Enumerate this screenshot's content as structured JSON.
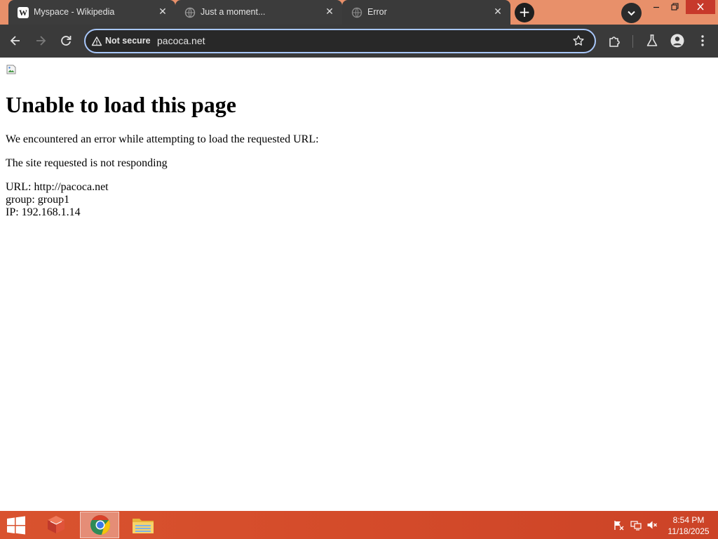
{
  "browser": {
    "tabs": [
      {
        "title": "Myspace - Wikipedia",
        "favicon": "wikipedia-icon",
        "active": false
      },
      {
        "title": "Just a moment...",
        "favicon": "globe-icon",
        "active": false
      },
      {
        "title": "Error",
        "favicon": "globe-icon",
        "active": true
      }
    ],
    "close_glyph": "✕",
    "new_tab_glyph": "+",
    "omnibox": {
      "security_label": "Not secure",
      "url": "pacoca.net"
    }
  },
  "page": {
    "heading": "Unable to load this page",
    "intro": "We encountered an error while attempting to load the requested URL:",
    "reason": "The site requested is not responding",
    "url_line": "URL: http://pacoca.net",
    "group_line": "group: group1",
    "ip_line": "IP: 192.168.1.14"
  },
  "taskbar": {
    "time": "8:54 PM",
    "date": "11/18/2025",
    "accent": "#d44b2a"
  }
}
